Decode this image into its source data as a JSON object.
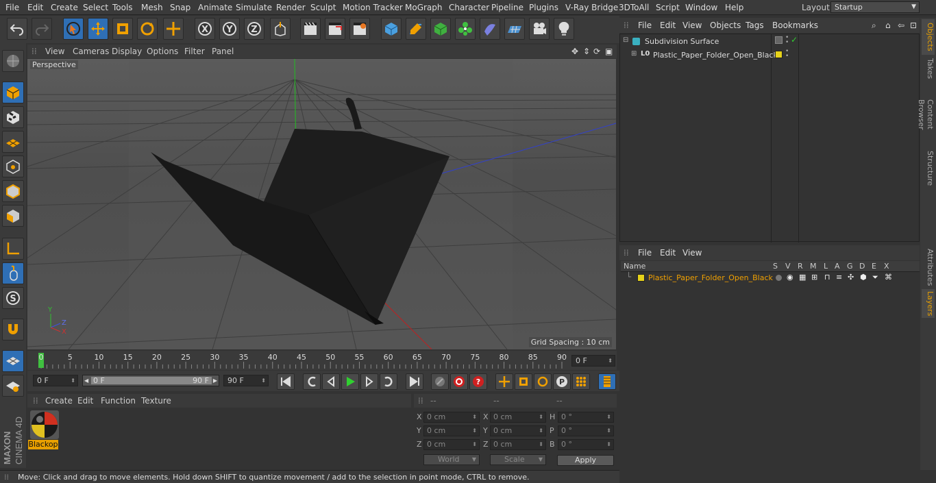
{
  "menubar": {
    "items": [
      "File",
      "Edit",
      "Create",
      "Select",
      "Tools",
      "Mesh",
      "Snap",
      "Animate",
      "Simulate",
      "Render",
      "Sculpt",
      "Motion Tracker",
      "MoGraph",
      "Character",
      "Pipeline",
      "Plugins",
      "V-Ray Bridge",
      "3DToAll",
      "Script",
      "Window",
      "Help"
    ],
    "layout_label": "Layout:",
    "layout_value": "Startup"
  },
  "toolbar": {
    "icons": [
      "undo-icon",
      "redo-icon",
      "select-arrow-icon",
      "move-icon",
      "scale-icon",
      "rotate-icon",
      "move-add-icon",
      "x-axis-icon",
      "y-axis-icon",
      "z-axis-icon",
      "coord-system-icon",
      "render-view-icon",
      "render-picture-viewer-icon",
      "render-settings-icon",
      "cube-icon",
      "pen-icon",
      "subdivision-icon",
      "cloner-icon",
      "deformer-icon",
      "floor-icon",
      "camera-icon",
      "light-icon"
    ]
  },
  "left_toolbar": {
    "icons": [
      "view-icon",
      "model-mode-icon",
      "texture-mode-icon",
      "workplane-icon",
      "points-mode-icon",
      "edges-mode-icon",
      "polygons-mode-icon",
      "axis-icon",
      "tweak-icon",
      "solo-icon",
      "magnet-icon",
      "snap-grid-icon",
      "snap-settings-icon"
    ]
  },
  "brand": {
    "maxon": "MAXON",
    "cinema": "CINEMA 4D"
  },
  "viewport": {
    "menu": [
      "View",
      "Cameras",
      "Display",
      "Options",
      "Filter",
      "Panel"
    ],
    "camera_label": "Perspective",
    "grid_spacing": "Grid Spacing : 10 cm",
    "axis_labels": {
      "y": "Y",
      "z": "Z",
      "x": "X"
    }
  },
  "timeline": {
    "ticks": [
      "0",
      "5",
      "10",
      "15",
      "20",
      "25",
      "30",
      "35",
      "40",
      "45",
      "50",
      "55",
      "60",
      "65",
      "70",
      "75",
      "80",
      "85",
      "90"
    ],
    "current_frame": "0 F"
  },
  "transport": {
    "start_field": "0 F",
    "range_start": "0 F",
    "range_end": "90 F",
    "end_field": "90 F",
    "range_progress": 1.0
  },
  "materials": {
    "menu": [
      "Create",
      "Edit",
      "Function",
      "Texture"
    ],
    "items": [
      {
        "name": "Blackop"
      }
    ]
  },
  "coordinates": {
    "headers": [
      "--",
      "--",
      "--"
    ],
    "rows": [
      {
        "a_label": "X",
        "a_val": "0 cm",
        "b_label": "X",
        "b_val": "0 cm",
        "c_label": "H",
        "c_val": "0 °"
      },
      {
        "a_label": "Y",
        "a_val": "0 cm",
        "b_label": "Y",
        "b_val": "0 cm",
        "c_label": "P",
        "c_val": "0 °"
      },
      {
        "a_label": "Z",
        "a_val": "0 cm",
        "b_label": "Z",
        "b_val": "0 cm",
        "c_label": "B",
        "c_val": "0 °"
      }
    ],
    "mode_world": "World",
    "mode_scale": "Scale",
    "apply_label": "Apply"
  },
  "object_manager": {
    "menu": [
      "File",
      "Edit",
      "View",
      "Objects",
      "Tags",
      "Bookmarks"
    ],
    "objects": [
      {
        "name": "Subdivision Surface"
      },
      {
        "name": "Plastic_Paper_Folder_Open_Black"
      }
    ],
    "layer_color": "#e6d21a"
  },
  "layer_manager": {
    "menu": [
      "File",
      "Edit",
      "View"
    ],
    "columns": [
      "Name",
      "S",
      "V",
      "R",
      "M",
      "L",
      "A",
      "G",
      "D",
      "E",
      "X"
    ],
    "layers": [
      {
        "name": "Plastic_Paper_Folder_Open_Black"
      }
    ]
  },
  "right_tabs": [
    "Objects",
    "Takes",
    "Content Browser",
    "Structure",
    "Attributes",
    "Layers"
  ],
  "status": {
    "text": "Move: Click and drag to move elements. Hold down SHIFT to quantize movement / add to the selection in point mode, CTRL to remove."
  },
  "colors": {
    "accent": "#e8a000",
    "selected_text": "#f0a000",
    "active_blue": "#2f6fb5"
  }
}
